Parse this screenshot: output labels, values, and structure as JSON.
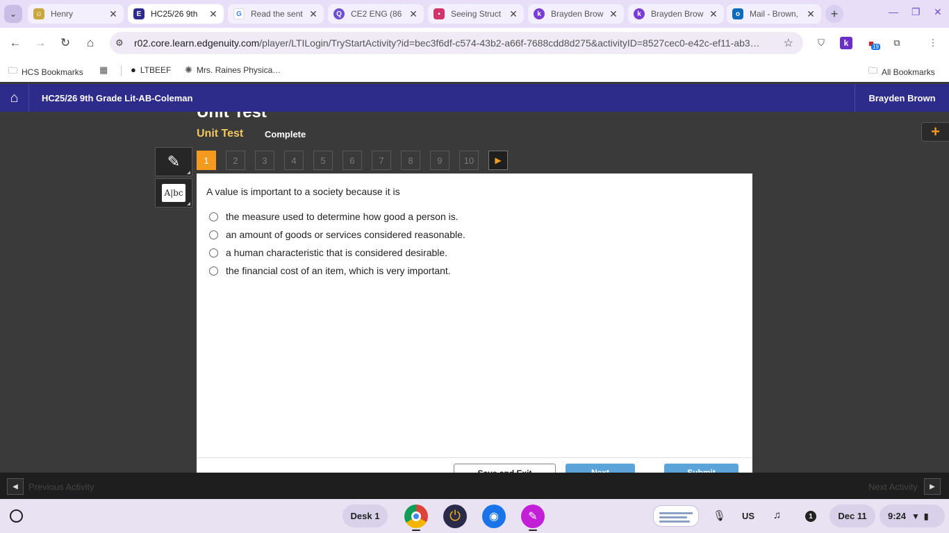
{
  "browser": {
    "tabs": [
      {
        "title": "Henry",
        "icon": "henry-favicon-icon"
      },
      {
        "title": "HC25/26 9th",
        "icon": "edgenuity-favicon-icon",
        "active": true
      },
      {
        "title": "Read the sent",
        "icon": "google-favicon-icon"
      },
      {
        "title": "CE2 ENG (86",
        "icon": "quizizz-favicon-icon"
      },
      {
        "title": "Seeing Struct",
        "icon": "schoology-favicon-icon"
      },
      {
        "title": "Brayden Brow",
        "icon": "kami-favicon-icon"
      },
      {
        "title": "Brayden Brow",
        "icon": "kami-favicon-icon"
      },
      {
        "title": "Mail - Brown,",
        "icon": "outlook-favicon-icon"
      }
    ],
    "url_host": "r02.core.learn.edgenuity.com",
    "url_rest": "/player/LTILogin/TryStartActivity?id=bec3f6df-c574-43b2-a66f-7688cdd8d275&activityID=8527cec0-e42c-ef11-ab3…",
    "extension_badge": "19",
    "bookmarks": [
      {
        "label": "HCS Bookmarks",
        "icon": "folder-icon"
      },
      {
        "label": "",
        "icon": "apps-grid-icon"
      },
      {
        "label": "LTBEEF",
        "icon": "globe-icon"
      },
      {
        "label": "Mrs. Raines Physica…",
        "icon": "page-icon"
      }
    ],
    "all_bookmarks": "All Bookmarks"
  },
  "course": {
    "title": "HC25/26 9th Grade Lit-AB-Coleman",
    "user": "Brayden Brown"
  },
  "activity": {
    "heading": "Unit Test",
    "subheading": "Unit Test",
    "status": "Complete",
    "questions": [
      "1",
      "2",
      "3",
      "4",
      "5",
      "6",
      "7",
      "8",
      "9",
      "10"
    ],
    "current_question": "1",
    "stem": "A value is important to a society because it is",
    "options": [
      "the measure used to determine how good a person is.",
      "an amount of goods or services considered reasonable.",
      "a human characteristic that is considered desirable.",
      "the financial cost of an item, which is very important."
    ],
    "footer_buttons": {
      "save": "Save and Exit",
      "next": "Next",
      "submit": "Submit"
    },
    "prev_activity": "Previous Activity",
    "next_activity": "Next Activity"
  },
  "shelf": {
    "desk": "Desk 1",
    "locale": "US",
    "notification_count": "1",
    "date": "Dec 11",
    "time": "9:24"
  }
}
